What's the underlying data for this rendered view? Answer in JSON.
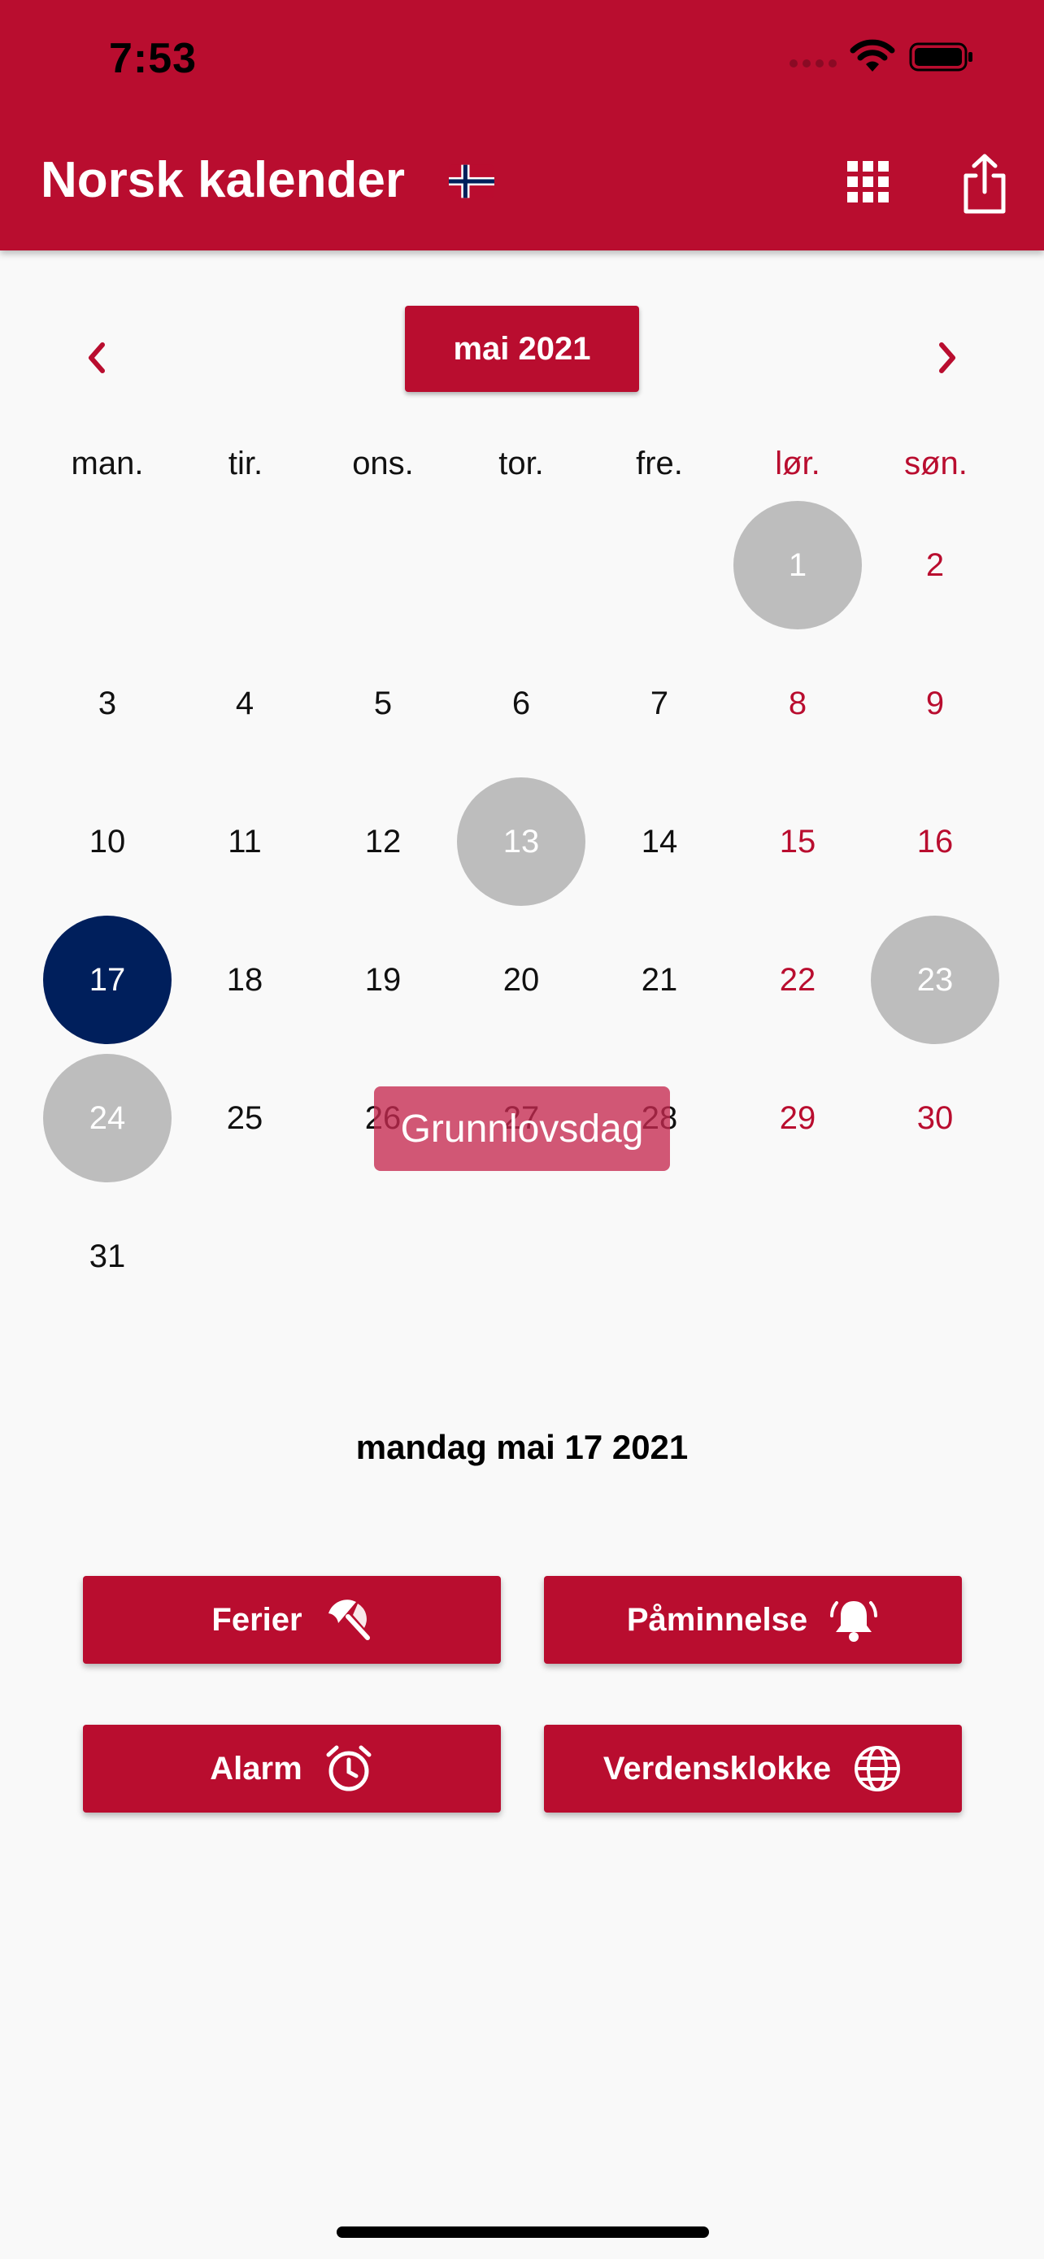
{
  "status_bar": {
    "time": "7:53"
  },
  "header": {
    "title": "Norsk kalender"
  },
  "calendar": {
    "month_label": "mai 2021",
    "weekdays": [
      "man.",
      "tir.",
      "ons.",
      "tor.",
      "fre.",
      "lør.",
      "søn."
    ],
    "days": [
      "1",
      "2",
      "3",
      "4",
      "5",
      "6",
      "7",
      "8",
      "9",
      "10",
      "11",
      "12",
      "13",
      "14",
      "15",
      "16",
      "17",
      "18",
      "19",
      "20",
      "21",
      "22",
      "23",
      "24",
      "25",
      "26",
      "27",
      "28",
      "29",
      "30",
      "31"
    ],
    "holidays": [
      1,
      13,
      17,
      23,
      24
    ],
    "selected_day": 17,
    "tooltip": "Grunnlovsdag"
  },
  "selected_date_label": "mandag mai 17 2021",
  "actions": {
    "holidays": "Ferier",
    "reminder": "Påminnelse",
    "alarm": "Alarm",
    "world_clock": "Verdensklokke"
  },
  "colors": {
    "accent": "#b90d2f",
    "selected": "#001f5c",
    "holiday": "#bdbdbd"
  }
}
